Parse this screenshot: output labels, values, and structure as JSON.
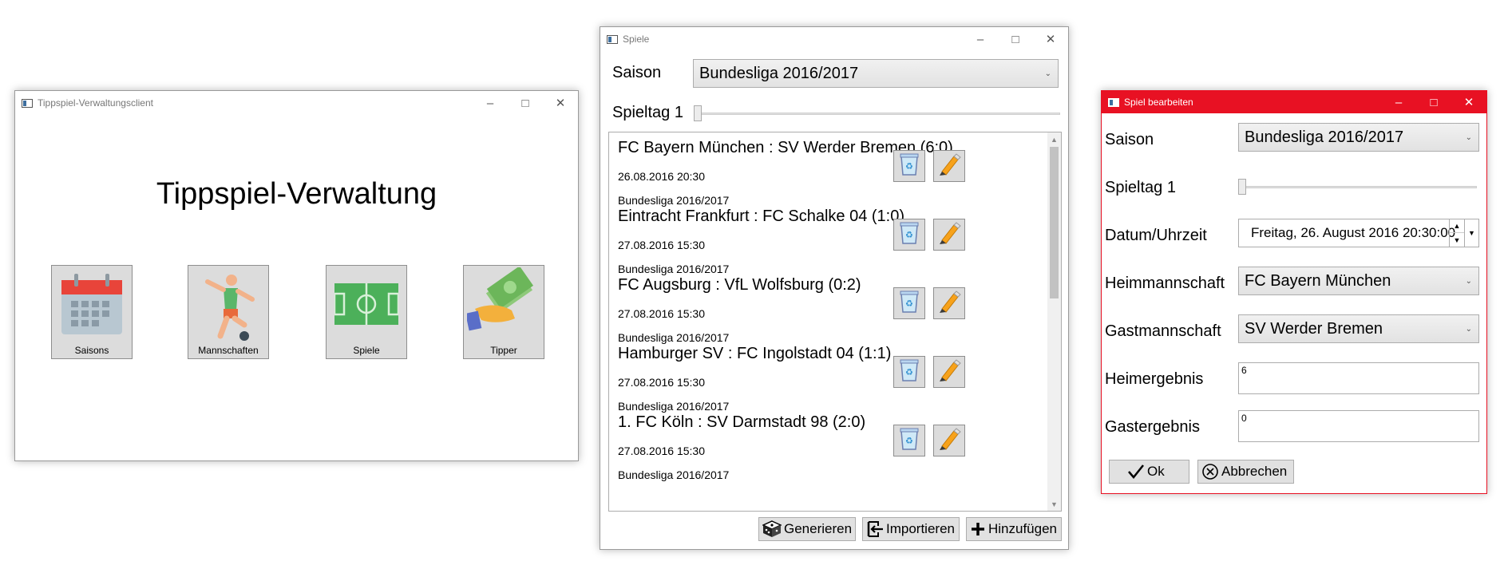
{
  "main_window": {
    "title": "Tippspiel-Verwaltungsclient",
    "heading": "Tippspiel-Verwaltung",
    "tiles": [
      {
        "label": "Saisons",
        "icon": "calendar-icon"
      },
      {
        "label": "Mannschaften",
        "icon": "soccer-player-icon"
      },
      {
        "label": "Spiele",
        "icon": "soccer-field-icon"
      },
      {
        "label": "Tipper",
        "icon": "money-hand-icon"
      }
    ]
  },
  "games_window": {
    "title": "Spiele",
    "season_label": "Saison",
    "season_value": "Bundesliga 2016/2017",
    "matchday_label": "Spieltag 1",
    "matchday_slider": 0,
    "games": [
      {
        "match": "FC Bayern München : SV Werder Bremen (6:0)",
        "datetime": "26.08.2016 20:30",
        "season": "Bundesliga 2016/2017"
      },
      {
        "match": "Eintracht Frankfurt : FC Schalke 04 (1:0)",
        "datetime": "27.08.2016 15:30",
        "season": "Bundesliga 2016/2017"
      },
      {
        "match": "FC Augsburg : VfL Wolfsburg (0:2)",
        "datetime": "27.08.2016 15:30",
        "season": "Bundesliga 2016/2017"
      },
      {
        "match": "Hamburger SV : FC Ingolstadt 04 (1:1)",
        "datetime": "27.08.2016 15:30",
        "season": "Bundesliga 2016/2017"
      },
      {
        "match": "1. FC Köln : SV Darmstadt 98 (2:0)",
        "datetime": "27.08.2016 15:30",
        "season": "Bundesliga 2016/2017"
      }
    ],
    "buttons": {
      "generate": "Generieren",
      "import": "Importieren",
      "add": "Hinzufügen"
    }
  },
  "edit_window": {
    "title": "Spiel bearbeiten",
    "season_label": "Saison",
    "season_value": "Bundesliga 2016/2017",
    "matchday_label": "Spieltag 1",
    "datetime_label": "Datum/Uhrzeit",
    "datetime_value": "Freitag, 26. August 2016 20:30:00",
    "home_label": "Heimmannschaft",
    "home_value": "FC Bayern München",
    "away_label": "Gastmannschaft",
    "away_value": "SV Werder Bremen",
    "home_result_label": "Heimergebnis",
    "home_result_value": "6",
    "away_result_label": "Gastergebnis",
    "away_result_value": "0",
    "ok_label": "Ok",
    "cancel_label": "Abbrechen"
  },
  "colors": {
    "accent_red": "#e81123",
    "tile_bg": "#dcdcdc",
    "button_bg": "#e1e1e1"
  }
}
